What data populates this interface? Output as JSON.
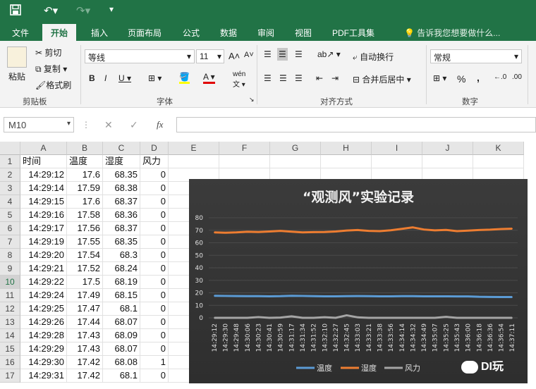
{
  "titlebar": {
    "save_icon": "save-icon",
    "undo_icon": "undo-icon",
    "redo_icon": "redo-icon",
    "customize_icon": "customize-icon"
  },
  "tabs": [
    "文件",
    "开始",
    "插入",
    "页面布局",
    "公式",
    "数据",
    "审阅",
    "视图",
    "PDF工具集"
  ],
  "tell_me": "告诉我您想要做什么...",
  "ribbon": {
    "paste": "粘贴",
    "cut": "剪切",
    "copy": "复制",
    "format_painter": "格式刷",
    "clipboard_label": "剪贴板",
    "font_name": "等线",
    "font_size": "11",
    "font_label": "字体",
    "wrap_text": "自动换行",
    "merge_center": "合并后居中",
    "alignment_label": "对齐方式",
    "number_format": "常规",
    "number_label": "数字",
    "percent": "%",
    "comma": ","
  },
  "formula_bar": {
    "name_box": "M10",
    "fx": "fx",
    "formula": ""
  },
  "sheet": {
    "columns": [
      "A",
      "B",
      "C",
      "D",
      "E",
      "F",
      "G",
      "H",
      "I",
      "J",
      "K"
    ],
    "rows": [
      "1",
      "2",
      "3",
      "4",
      "5",
      "6",
      "7",
      "8",
      "9",
      "10",
      "11",
      "12",
      "13",
      "14",
      "15",
      "16",
      "17"
    ],
    "header": [
      "时间",
      "温度",
      "湿度",
      "风力"
    ],
    "data": [
      [
        "14:29:12",
        "17.6",
        "68.35",
        "0"
      ],
      [
        "14:29:14",
        "17.59",
        "68.38",
        "0"
      ],
      [
        "14:29:15",
        "17.6",
        "68.37",
        "0"
      ],
      [
        "14:29:16",
        "17.58",
        "68.36",
        "0"
      ],
      [
        "14:29:17",
        "17.56",
        "68.37",
        "0"
      ],
      [
        "14:29:19",
        "17.55",
        "68.35",
        "0"
      ],
      [
        "14:29:20",
        "17.54",
        "68.3",
        "0"
      ],
      [
        "14:29:21",
        "17.52",
        "68.24",
        "0"
      ],
      [
        "14:29:22",
        "17.5",
        "68.19",
        "0"
      ],
      [
        "14:29:24",
        "17.49",
        "68.15",
        "0"
      ],
      [
        "14:29:25",
        "17.47",
        "68.1",
        "0"
      ],
      [
        "14:29:26",
        "17.44",
        "68.07",
        "0"
      ],
      [
        "14:29:28",
        "17.43",
        "68.09",
        "0"
      ],
      [
        "14:29:29",
        "17.43",
        "68.07",
        "0"
      ],
      [
        "14:29:30",
        "17.42",
        "68.08",
        "1"
      ],
      [
        "14:29:31",
        "17.42",
        "68.1",
        "0"
      ]
    ]
  },
  "chart_data": {
    "type": "line",
    "title": "“观测风”实验记录",
    "ylim": [
      0,
      80
    ],
    "yticks": [
      "0",
      "10",
      "20",
      "30",
      "40",
      "50",
      "60",
      "70",
      "80"
    ],
    "categories": [
      "14:29:12",
      "14:29:30",
      "14:29:48",
      "14:30:06",
      "14:30:23",
      "14:30:41",
      "14:30:59",
      "14:31:17",
      "14:31:34",
      "14:31:52",
      "14:32:10",
      "14:32:27",
      "14:32:45",
      "14:33:03",
      "14:33:21",
      "14:33:38",
      "14:33:56",
      "14:34:14",
      "14:34:32",
      "14:34:49",
      "14:35:07",
      "14:35:25",
      "14:35:43",
      "14:36:00",
      "14:36:18",
      "14:36:36",
      "14:36:54",
      "14:37:11"
    ],
    "series": [
      {
        "name": "温度",
        "color": "#5b9bd5",
        "values": [
          17.6,
          17.5,
          17.4,
          17.3,
          17.3,
          17.2,
          17.3,
          17.6,
          17.5,
          17.3,
          17.2,
          17.2,
          17.3,
          17.4,
          17.3,
          17.2,
          17.2,
          17.3,
          17.3,
          17.2,
          17.2,
          17.2,
          17.1,
          17.1,
          16.8,
          16.7,
          16.6,
          16.6
        ]
      },
      {
        "name": "湿度",
        "color": "#ed7d31",
        "values": [
          68.3,
          68.0,
          68.3,
          68.8,
          68.6,
          69.0,
          69.5,
          68.9,
          68.3,
          68.5,
          68.6,
          69.0,
          69.8,
          70.2,
          69.5,
          69.3,
          70.0,
          71.1,
          72.3,
          70.6,
          69.9,
          70.3,
          69.3,
          69.7,
          70.2,
          70.5,
          71.0,
          71.3
        ]
      },
      {
        "name": "风力",
        "color": "#a5a5a5",
        "values": [
          0,
          0,
          0,
          0,
          0.6,
          0,
          0.2,
          1.2,
          0,
          0,
          0.5,
          0,
          2,
          0.4,
          0,
          0,
          0,
          0,
          0,
          0,
          0,
          0.8,
          0,
          0,
          0,
          0,
          0,
          0
        ]
      }
    ]
  },
  "watermark": "DI玩"
}
